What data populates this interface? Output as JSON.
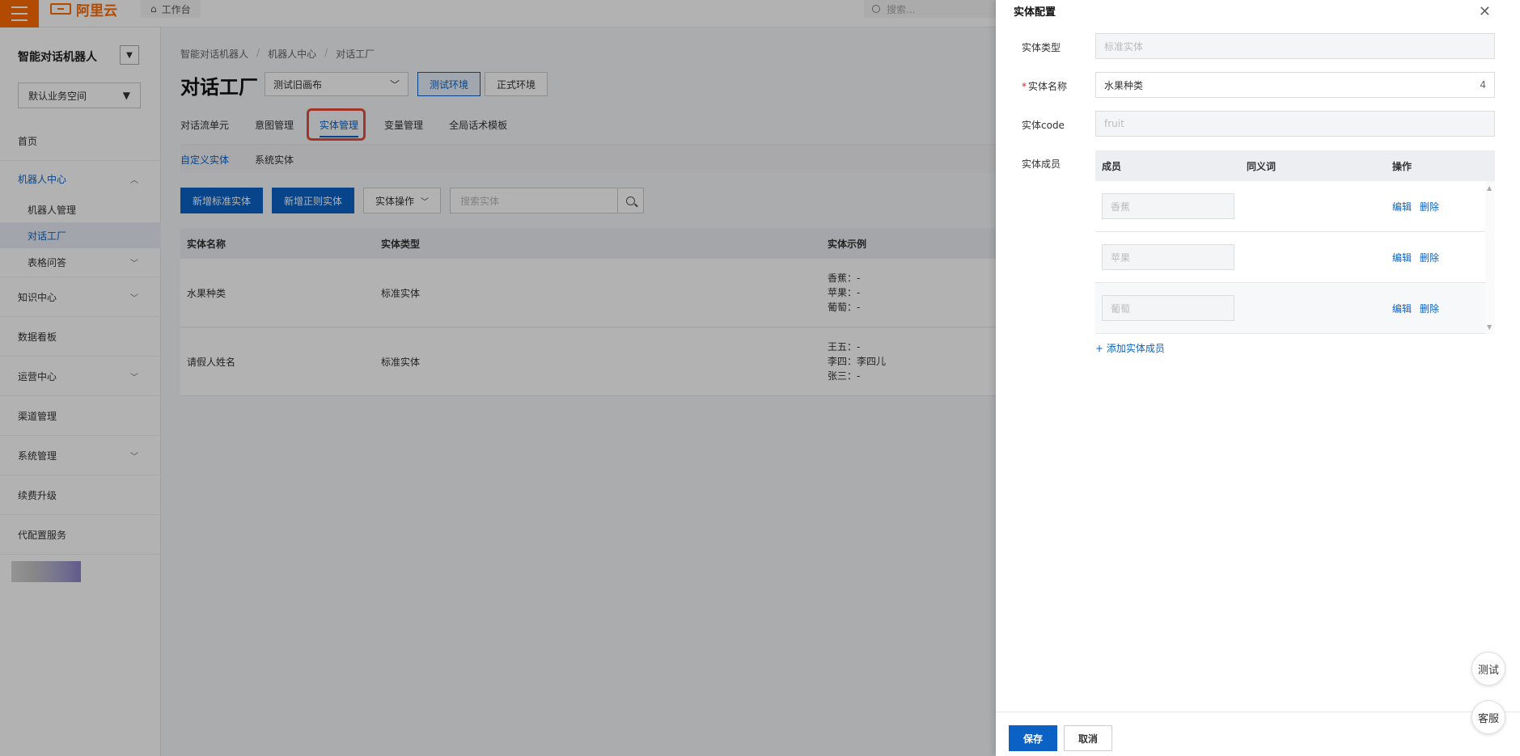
{
  "topbar": {
    "brand": "阿里云",
    "workbench": "工作台",
    "search_placeholder": "搜索..."
  },
  "sidebar": {
    "title": "智能对话机器人",
    "space": "默认业务空间",
    "items": [
      {
        "label": "首页"
      },
      {
        "label": "机器人中心"
      },
      {
        "label": "机器人管理"
      },
      {
        "label": "对话工厂"
      },
      {
        "label": "表格问答"
      },
      {
        "label": "知识中心"
      },
      {
        "label": "数据看板"
      },
      {
        "label": "运营中心"
      },
      {
        "label": "渠道管理"
      },
      {
        "label": "系统管理"
      },
      {
        "label": "续费升级"
      },
      {
        "label": "代配置服务"
      }
    ]
  },
  "main": {
    "breadcrumb": [
      "智能对话机器人",
      "机器人中心",
      "对话工厂"
    ],
    "title": "对话工厂",
    "env_select": "测试旧画布",
    "env_test": "测试环境",
    "env_prod": "正式环境",
    "tabs": [
      "对话流单元",
      "意图管理",
      "实体管理",
      "变量管理",
      "全局话术模板"
    ],
    "subtabs": [
      "自定义实体",
      "系统实体"
    ],
    "buttons": {
      "add_standard": "新增标准实体",
      "add_regex": "新增正则实体",
      "entity_ops": "实体操作"
    },
    "search_placeholder": "搜索实体",
    "table": {
      "headers": [
        "实体名称",
        "实体类型",
        "实体示例"
      ],
      "rows": [
        {
          "name": "水果种类",
          "type": "标准实体",
          "examples": [
            "香蕉：-",
            "苹果：-",
            "葡萄：-"
          ]
        },
        {
          "name": "请假人姓名",
          "type": "标准实体",
          "examples": [
            "王五：-",
            "李四：李四儿",
            "张三：-"
          ]
        }
      ]
    }
  },
  "drawer": {
    "title": "实体配置",
    "labels": {
      "type": "实体类型",
      "name": "实体名称",
      "code": "实体code",
      "members": "实体成员"
    },
    "type_value": "标准实体",
    "name_value": "水果种类",
    "name_count": "4",
    "code_value": "fruit",
    "member_headers": [
      "成员",
      "同义词",
      "操作"
    ],
    "members": [
      {
        "value": "香蕉",
        "edit": "编辑",
        "delete": "删除"
      },
      {
        "value": "苹果",
        "edit": "编辑",
        "delete": "删除"
      },
      {
        "value": "葡萄",
        "edit": "编辑",
        "delete": "删除"
      }
    ],
    "add_member": "+ 添加实体成员",
    "save": "保存",
    "cancel": "取消"
  },
  "floating": {
    "test": "测试",
    "service": "客服"
  },
  "colors": {
    "brand_orange": "#ff6a00",
    "primary_blue": "#0b62c4",
    "highlight_red": "#e74c3c"
  }
}
